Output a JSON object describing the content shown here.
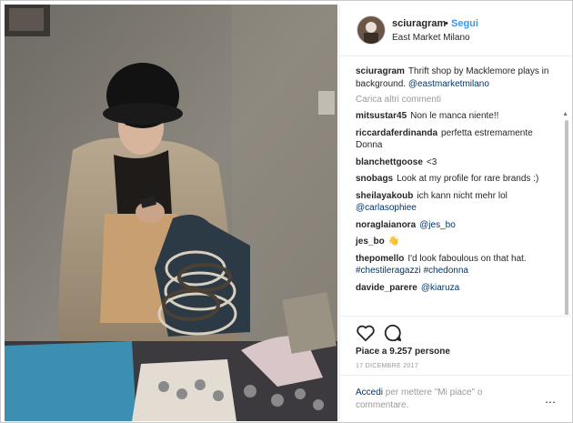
{
  "header": {
    "username": "sciuragram",
    "separator": "•",
    "follow_label": "Segui",
    "location": "East Market Milano"
  },
  "caption": {
    "username": "sciuragram",
    "text": "Thrift shop by Macklemore plays in background.",
    "tag": "@eastmarketmilano"
  },
  "load_more_label": "Carica altri commenti",
  "comments": [
    {
      "user": "mitsustar45",
      "text": "Non le manca niente!!",
      "tag": ""
    },
    {
      "user": "riccardaferdinanda",
      "text": "perfetta estremamente Donna",
      "tag": ""
    },
    {
      "user": "blanchettgoose",
      "text": "<3",
      "tag": ""
    },
    {
      "user": "snobags",
      "text": "Look at my profile for rare brands :)",
      "tag": ""
    },
    {
      "user": "sheilayakoub",
      "text": "ich kann nicht mehr lol",
      "tag": "@carlasophiee"
    },
    {
      "user": "noraglaianora",
      "text": "",
      "tag": "@jes_bo"
    },
    {
      "user": "jes_bo",
      "text": "👋",
      "tag": ""
    },
    {
      "user": "thepomello",
      "text": "I'd look faboulous on that hat.",
      "tag": "#chestileragazzi #chedonna"
    },
    {
      "user": "davide_parere",
      "text": "",
      "tag": "@kiaruza"
    }
  ],
  "actions": {
    "like_icon": "heart-outline-icon",
    "comment_icon": "comment-bubble-icon",
    "likes_text": "Piace a 9.257 persone",
    "date": "17 DICEMBRE 2017"
  },
  "login": {
    "link": "Accedi",
    "text": " per mettere \"Mi piace\" o commentare.",
    "more_icon": "⋯"
  },
  "colors": {
    "link_blue": "#3897f0",
    "tag_dark_blue": "#003569",
    "muted_gray": "#999999",
    "text": "#262626"
  }
}
